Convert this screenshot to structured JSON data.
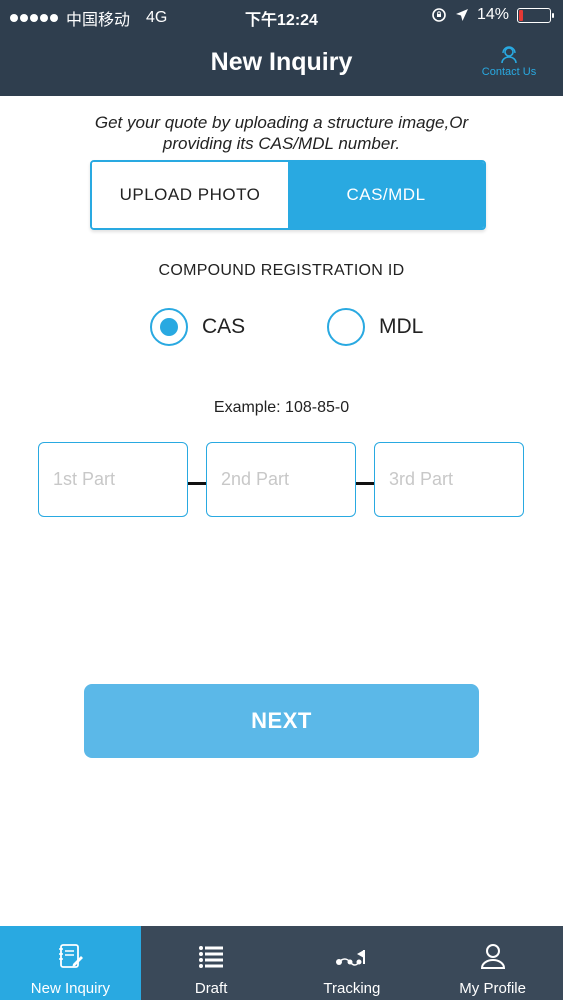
{
  "status_bar": {
    "carrier": "中国移动",
    "network": "4G",
    "time": "下午12:24",
    "battery": "14%",
    "battery_level": 0.14
  },
  "nav": {
    "title": "New Inquiry",
    "contact_label": "Contact Us"
  },
  "intro": {
    "line1": "Get your quote by uploading a structure image,Or",
    "line2": "providing its CAS/MDL number."
  },
  "segmented": {
    "upload_label": "UPLOAD PHOTO",
    "cas_label": "CAS/MDL",
    "selected": "CAS/MDL"
  },
  "registration": {
    "label": "COMPOUND REGISTRATION ID",
    "options": [
      "CAS",
      "MDL"
    ],
    "selected": "CAS"
  },
  "example": "Example: 108-85-0",
  "cas_inputs": {
    "part1": {
      "value": "",
      "placeholder": "1st Part"
    },
    "part2": {
      "value": "",
      "placeholder": "2nd Part"
    },
    "part3": {
      "value": "",
      "placeholder": "3rd Part"
    }
  },
  "next_label": "NEXT",
  "tabs": [
    {
      "label": "New Inquiry",
      "icon": "notepad-icon",
      "active": true
    },
    {
      "label": "Draft",
      "icon": "list-icon",
      "active": false
    },
    {
      "label": "Tracking",
      "icon": "route-icon",
      "active": false
    },
    {
      "label": "My Profile",
      "icon": "person-icon",
      "active": false
    }
  ],
  "colors": {
    "header": "#2f3e4e",
    "accent": "#29a9e1",
    "next_button": "#5bb8e8",
    "tab_bar": "#3a4959"
  }
}
